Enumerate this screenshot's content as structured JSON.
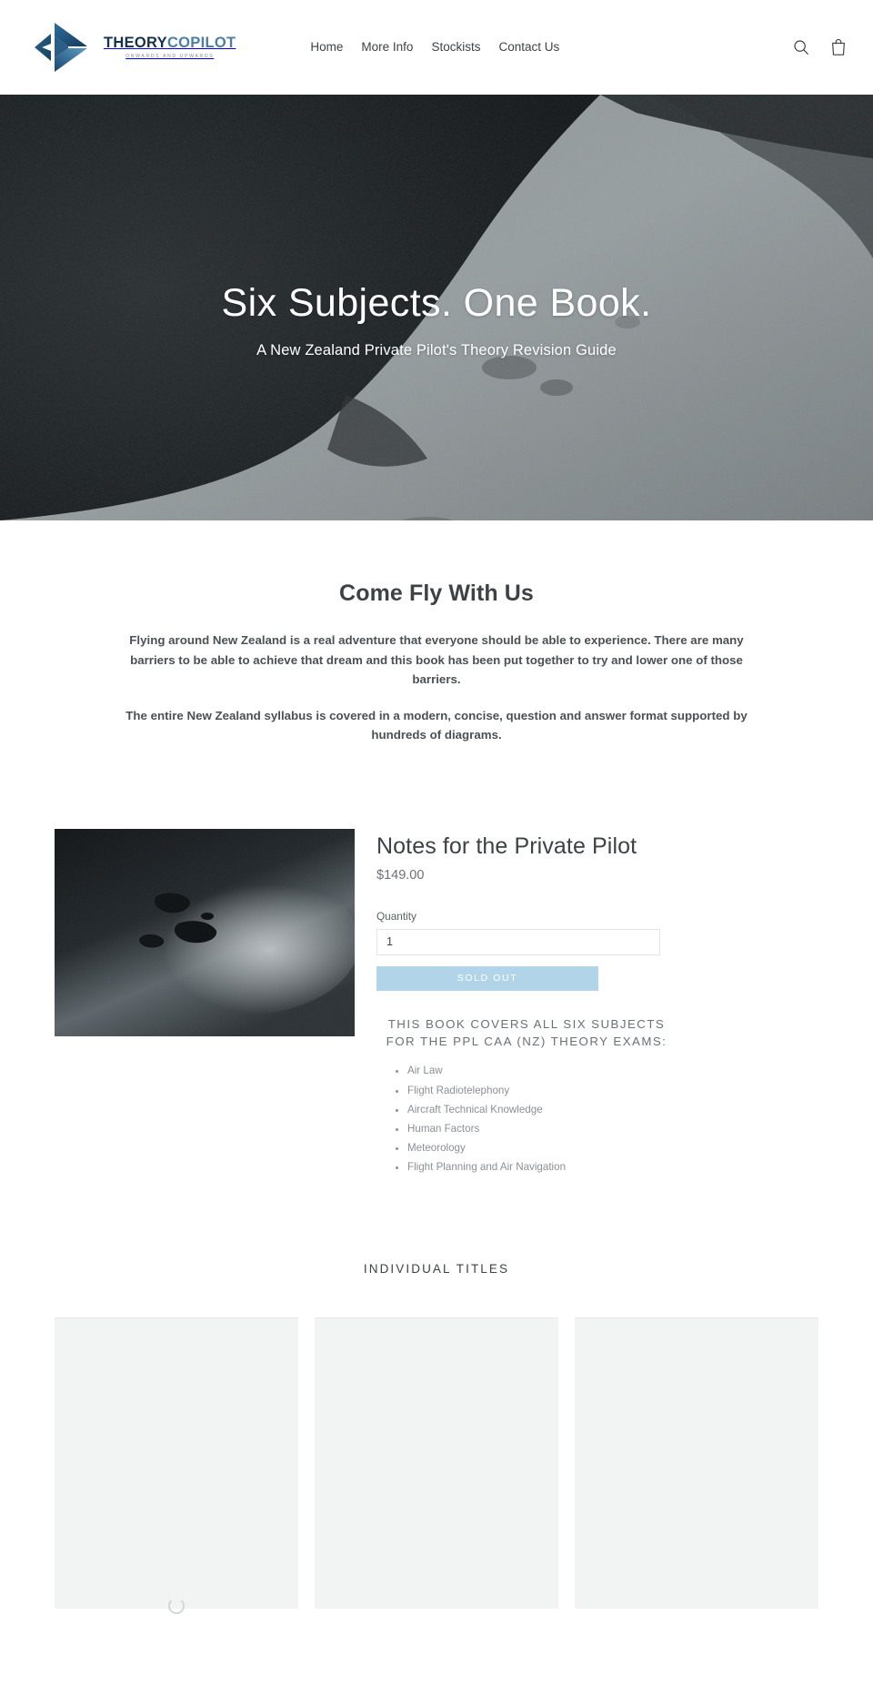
{
  "header": {
    "logo": {
      "word_primary": "THEORY",
      "word_secondary": "COPILOT",
      "tagline": "ONWARDS AND UPWARDS"
    },
    "nav": [
      {
        "label": "Home"
      },
      {
        "label": "More Info"
      },
      {
        "label": "Stockists"
      },
      {
        "label": "Contact Us"
      }
    ],
    "icons": {
      "search": "search-icon",
      "cart": "cart-icon"
    }
  },
  "hero": {
    "title": "Six Subjects. One Book.",
    "subtitle": "A New Zealand Private Pilot's Theory Revision Guide"
  },
  "intro": {
    "heading": "Come Fly With Us",
    "paragraph_1": "Flying around New Zealand is a real adventure that everyone should be able to experience. There are many barriers to be able to achieve that dream and this book has been put together to try and lower one of those barriers.",
    "paragraph_2": "The entire New Zealand syllabus is covered in a modern, concise, question and answer format supported by hundreds of diagrams."
  },
  "product": {
    "title": "Notes for the Private Pilot",
    "price": "$149.00",
    "quantity_label": "Quantity",
    "quantity_value": "1",
    "buy_button_label": "SOLD OUT",
    "covers_heading": "THIS BOOK COVERS ALL SIX SUBJECTS FOR THE PPL CAA (NZ) THEORY EXAMS:",
    "subjects": [
      "Air Law",
      "Flight Radiotelephony",
      "Aircraft Technical Knowledge",
      "Human Factors",
      "Meteorology",
      "Flight Planning and Air Navigation"
    ]
  },
  "individual_titles": {
    "heading": "INDIVIDUAL TITLES",
    "cards": [
      {
        "placeholder": ""
      },
      {
        "placeholder": ""
      },
      {
        "placeholder": ""
      }
    ]
  },
  "colors": {
    "logo_dark": "#16304a",
    "logo_light": "#4c7fa3",
    "sold_out_button": "#b2d4e8",
    "text": "#3d4246",
    "muted_text": "#8a9096",
    "card_placeholder": "#f2f3f3"
  }
}
